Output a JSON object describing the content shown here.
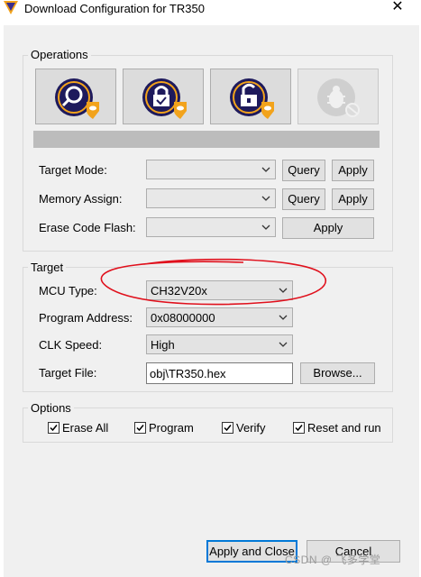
{
  "window": {
    "title": "Download Configuration for TR350",
    "close_glyph": "✕"
  },
  "operations": {
    "label": "Operations",
    "buttons": [
      {
        "name": "query-chip-button",
        "icon": "magnifier-shield-icon",
        "enabled": true
      },
      {
        "name": "lock-chip-button",
        "icon": "lock-shield-icon",
        "enabled": true
      },
      {
        "name": "unlock-chip-button",
        "icon": "unlock-shield-icon",
        "enabled": true
      },
      {
        "name": "disabled-bug-button",
        "icon": "bug-disabled-icon",
        "enabled": false
      }
    ],
    "rows": [
      {
        "label": "Target Mode:",
        "value": "",
        "query": "Query",
        "apply": "Apply"
      },
      {
        "label": "Memory Assign:",
        "value": "",
        "query": "Query",
        "apply": "Apply"
      },
      {
        "label": "Erase Code Flash:",
        "value": "",
        "apply": "Apply"
      }
    ]
  },
  "target": {
    "label": "Target",
    "mcu_type_label": "MCU Type:",
    "mcu_type_value": "CH32V20x",
    "program_address_label": "Program Address:",
    "program_address_value": "0x08000000",
    "clk_speed_label": "CLK Speed:",
    "clk_speed_value": "High",
    "target_file_label": "Target File:",
    "target_file_value": "obj\\TR350.hex",
    "browse_label": "Browse..."
  },
  "options": {
    "label": "Options",
    "checkboxes": [
      {
        "label": "Erase All",
        "checked": true
      },
      {
        "label": "Program",
        "checked": true
      },
      {
        "label": "Verify",
        "checked": true
      },
      {
        "label": "Reset and run",
        "checked": true
      }
    ]
  },
  "footer": {
    "apply_close_label": "Apply and Close",
    "cancel_label": "Cancel",
    "watermark": "CSDN @ 飞多学堂"
  },
  "colors": {
    "accent": "#0078d7",
    "annotation": "#e0101c",
    "icon_dark": "#1e1a5c",
    "icon_badge": "#f2a31c"
  }
}
